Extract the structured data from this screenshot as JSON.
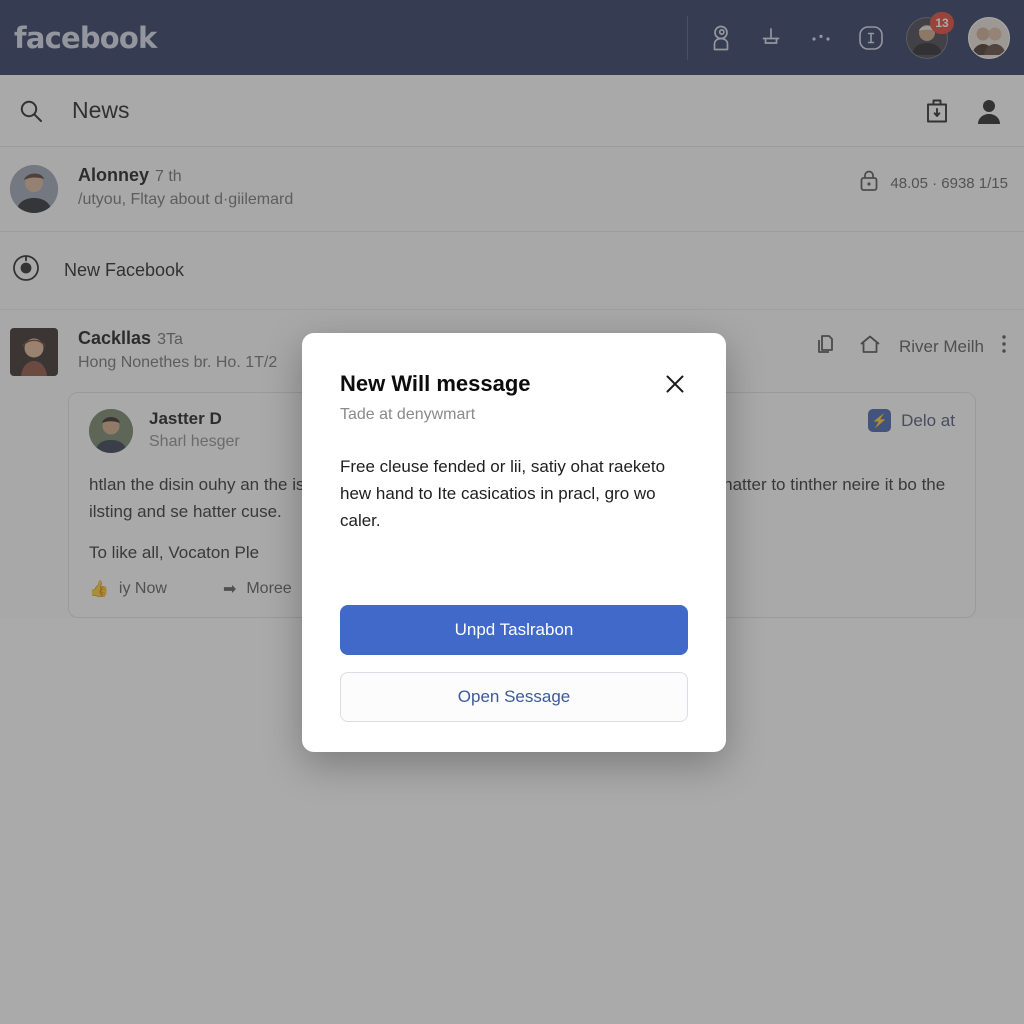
{
  "topbar": {
    "brand": "facebook",
    "icons": [
      {
        "name": "video-camera-icon",
        "glyph": "video"
      },
      {
        "name": "plug-icon",
        "glyph": "plug"
      },
      {
        "name": "more-dots-icon",
        "glyph": "dots"
      },
      {
        "name": "info-icon",
        "glyph": "info"
      }
    ],
    "notification_avatar": {
      "name": "notification-avatar",
      "badge": "13"
    },
    "profile_avatar": {
      "name": "profile-avatar"
    }
  },
  "subheader": {
    "search_icon": "search-icon",
    "title": "News",
    "right_icons": [
      {
        "name": "inbox-icon"
      },
      {
        "name": "person-icon"
      }
    ]
  },
  "feed": {
    "posts": [
      {
        "avatar_name": "post-avatar-alonney",
        "author": "Alonney",
        "time": "7 th",
        "subtitle": "/utyou, Fltay about d·giilemard",
        "meta_icon": "lock-icon",
        "meta_text": "48.05 · 6938 1/15"
      }
    ],
    "notice": {
      "icon": "clock-icon",
      "label": "New Facebook"
    },
    "second_post": {
      "avatar_name": "post-avatar-cackllas",
      "author": "Cackllas",
      "time": "3Ta",
      "subtitle": "Hong Nonethes br. Ho. 1T/2",
      "right_icons": [
        {
          "name": "copy-icon"
        },
        {
          "name": "home-icon"
        }
      ],
      "right_label": "River Meilh",
      "overflow_icon": "kebab-menu-icon"
    },
    "card": {
      "avatar_name": "card-avatar-jastter",
      "name": "Jastter D",
      "subtitle": "Sharl hesger",
      "chip_icon": "bolt-icon",
      "chip_glyph": "⚡",
      "chip_label": "Delo at",
      "body": "htlan the disin ouhy an the isco black, sepur deleratey edearmed , Chane, euch oun hatter to tinther neire it bo the ilsting and se hatter cuse.",
      "cta": "To like all, Vocaton Ple",
      "actions": [
        {
          "name": "like-action",
          "icon": "thumbs-up-icon",
          "glyph": "👍",
          "label": "iy Now"
        },
        {
          "name": "more-action",
          "icon": "arrow-right-icon",
          "glyph": "➡",
          "label": "Moree"
        }
      ]
    }
  },
  "modal": {
    "title": "New Will message",
    "subtitle": "Tade at denywmart",
    "close_icon": "close-icon",
    "body": "Free cleuse fended or lii, satiy ohat raeketo hew hand to Ite casicatios in pracl, gro wo caler.",
    "primary_button": "Unpd Taslrabon",
    "secondary_button": "Open Sessage"
  },
  "colors": {
    "topbar": "#253057",
    "primary": "#4169c9",
    "badge": "#e23b30",
    "link": "#3c5a9a"
  }
}
